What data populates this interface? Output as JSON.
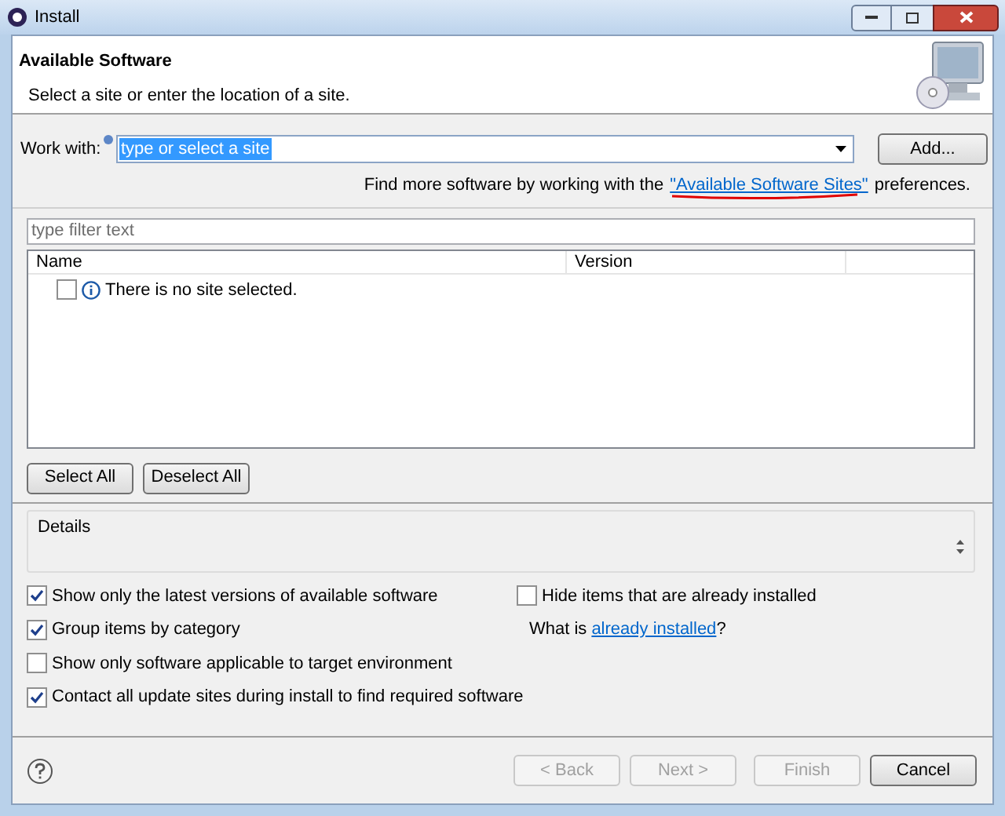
{
  "window": {
    "title": "Install"
  },
  "header": {
    "title": "Available Software",
    "subtitle": "Select a site or enter the location of a site."
  },
  "work_with": {
    "label": "Work with:",
    "value": "type or select a site",
    "button": "Add..."
  },
  "more_software": {
    "before": "Find more software by working with the",
    "link": "\"Available Software Sites\"",
    "after": "preferences."
  },
  "filter": {
    "placeholder": "type filter text"
  },
  "table": {
    "columns": [
      "Name",
      "Version"
    ],
    "rows": [
      {
        "text": "There is no site selected.",
        "checked": false
      }
    ]
  },
  "selection_buttons": [
    "Select All",
    "Deselect All"
  ],
  "details": {
    "title": "Details"
  },
  "options_left": [
    {
      "label": "Show only the latest versions of available software",
      "checked": true
    },
    {
      "label": "Group items by category",
      "checked": true
    },
    {
      "label": "Show only software applicable to target environment",
      "checked": false
    },
    {
      "label": "Contact all update sites during install to find required software",
      "checked": true
    }
  ],
  "options_right": [
    {
      "label": "Hide items that are already installed",
      "checked": false
    }
  ],
  "installed_note": {
    "before": "What is",
    "link": "already installed",
    "after": "?"
  },
  "buttons": [
    {
      "label": "< Back",
      "disabled": true
    },
    {
      "label": "Next >",
      "disabled": true
    },
    {
      "label": "Finish",
      "disabled": true
    },
    {
      "label": "Cancel",
      "disabled": false
    }
  ]
}
